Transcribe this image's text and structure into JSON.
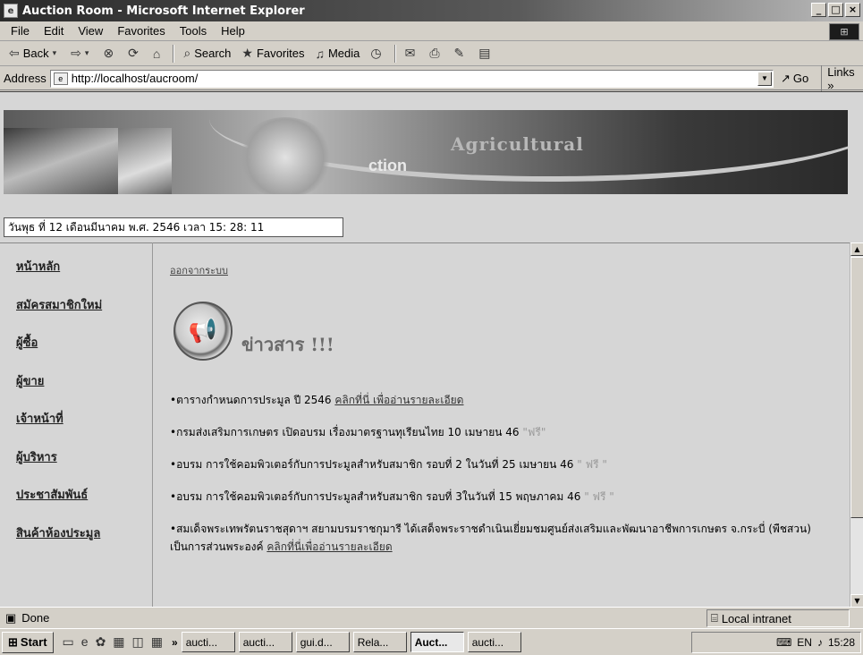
{
  "window": {
    "title": "Auction Room - Microsoft Internet Explorer",
    "controls": [
      "_",
      "□",
      "×"
    ]
  },
  "menu": [
    "File",
    "Edit",
    "View",
    "Favorites",
    "Tools",
    "Help"
  ],
  "toolbar": {
    "back": "Back",
    "search": "Search",
    "favorites": "Favorites",
    "media": "Media"
  },
  "address": {
    "label": "Address",
    "url": "http://localhost/aucroom/",
    "go": "Go",
    "links": "Links"
  },
  "banner": {
    "line1": "Agricultural",
    "line2": "ction"
  },
  "date_time": "วันพุธ ที่ 12 เดือนมีนาคม พ.ศ. 2546 เวลา 15: 28: 11",
  "sidebar": {
    "items": [
      {
        "label": "หน้าหลัก"
      },
      {
        "label": "สมัครสมาชิกใหม่"
      },
      {
        "label": "ผู้ซื้อ"
      },
      {
        "label": "ผู้ขาย"
      },
      {
        "label": "เจ้าหน้าที่"
      },
      {
        "label": "ผู้บริหาร"
      },
      {
        "label": "ประชาสัมพันธ์"
      },
      {
        "label": "สินค้าห้องประมูล"
      }
    ]
  },
  "main": {
    "logout": "ออกจากระบบ",
    "news_title": "ข่าวสาร !!!",
    "news": [
      {
        "text": "•ตารางกำหนดการประมูล ปี 2546 ",
        "link": "คลิกที่นี่ เพื่ออ่านรายละเอียด",
        "free": ""
      },
      {
        "text": "•กรมส่งเสริมการเกษตร เปิดอบรม เรื่องมาตรฐานทุเรียนไทย 10 เมษายน 46 ",
        "link": "",
        "free": "\"ฟรี\""
      },
      {
        "text": "•อบรม การใช้คอมพิวเตอร์กับการประมูลสำหรับสมาชิก รอบที่ 2 ในวันที่ 25 เมษายน 46 ",
        "link": "",
        "free": "\" ฟรี \""
      },
      {
        "text": "•อบรม การใช้คอมพิวเตอร์กับการประมูลสำหรับสมาชิก รอบที่ 3ในวันที่ 15 พฤษภาคม 46 ",
        "link": "",
        "free": "\" ฟรี \""
      },
      {
        "text": "•สมเด็จพระเทพรัตนราชสุดาฯ สยามบรมราชกุมารี ได้เสด็จพระราชดำเนินเยี่ยมชมศูนย์ส่งเสริมและพัฒนาอาชีพการเกษตร จ.กระบี่ (พืชสวน) เป็นการส่วนพระองค์ ",
        "link": "คลิกที่นี่เพื่ออ่านรายละเอียด",
        "free": ""
      }
    ]
  },
  "status": {
    "text": "Done",
    "zone": "Local intranet"
  },
  "taskbar": {
    "start": "Start",
    "more": "»",
    "tasks": [
      "aucti...",
      "aucti...",
      "gui.d...",
      "Rela...",
      "Auct...",
      "aucti..."
    ],
    "active_index": 4,
    "clock": "15:28"
  }
}
